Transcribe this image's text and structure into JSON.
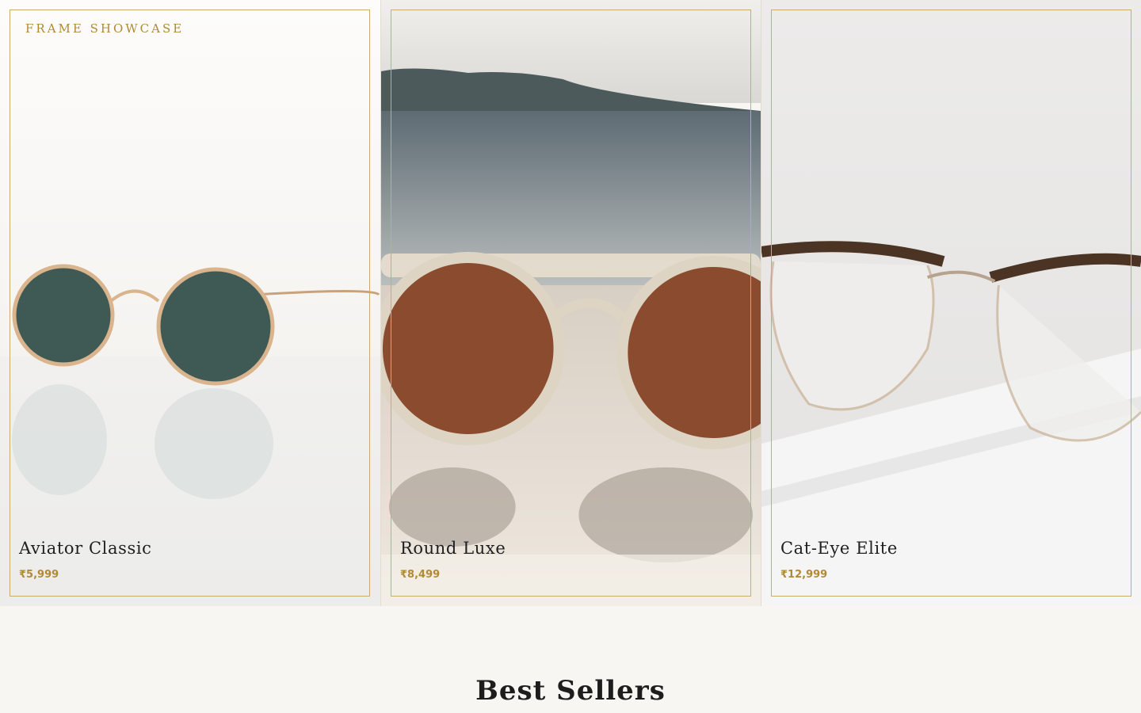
{
  "section_label": "FRAME SHOWCASE",
  "products": [
    {
      "name": "Aviator Classic",
      "price": "₹5,999"
    },
    {
      "name": "Round Luxe",
      "price": "₹8,499"
    },
    {
      "name": "Cat-Eye Elite",
      "price": "₹12,999"
    }
  ],
  "best_sellers_heading": "Best Sellers",
  "colors": {
    "gold": "#b08a35",
    "frame_border": "#c9ad6d",
    "background": "#f8f6f2"
  }
}
